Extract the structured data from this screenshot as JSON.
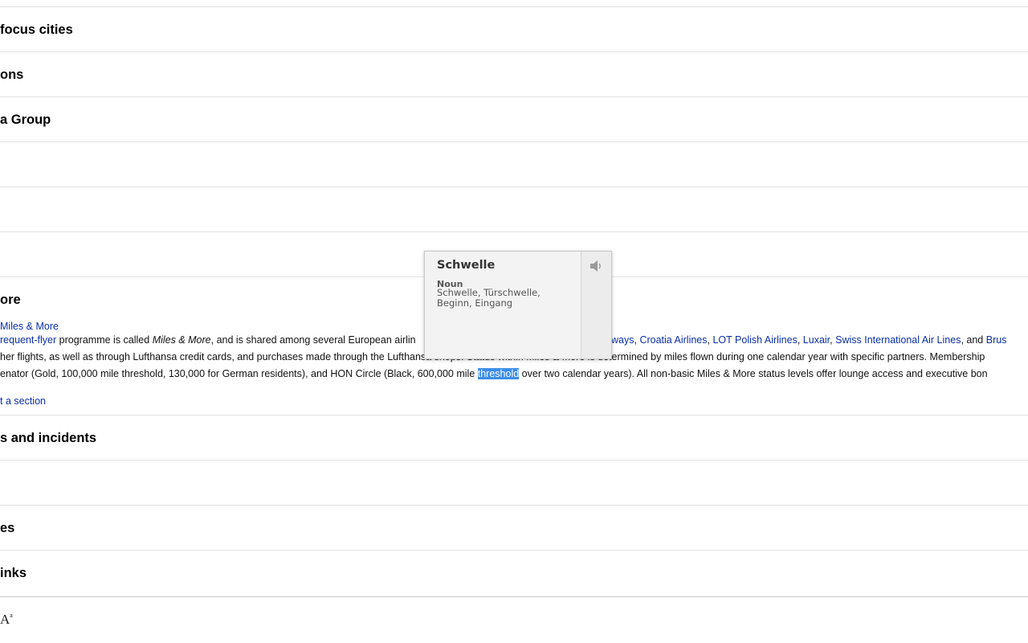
{
  "sections": [
    {
      "title": " focus cities"
    },
    {
      "title": "ons"
    },
    {
      "title": "a Group"
    },
    {
      "title": ""
    },
    {
      "title": ""
    },
    {
      "title": ""
    },
    {
      "title": "ore"
    },
    {
      "title": "s and incidents"
    },
    {
      "title": ""
    },
    {
      "title": "es"
    },
    {
      "title": "inks"
    }
  ],
  "main_article_link": "Miles & More",
  "paragraph": {
    "line1": {
      "link_frequent_flyer": "requent-flyer",
      "t1": " programme is called ",
      "em": "Miles & More",
      "t2": ", and is shared among several European airlin",
      "link_ways": "ways",
      "sep1": ", ",
      "link_croatia": "Croatia Airlines",
      "sep2": ", ",
      "link_lot": "LOT Polish Airlines",
      "sep3": ", ",
      "link_luxair": "Luxair",
      "sep4": ", ",
      "link_swiss": "Swiss International Air Lines",
      "t3": ", and ",
      "link_brus": "Brus"
    },
    "line2": {
      "t1": "her flights, as well as through Lufthansa credit cards, and purchases made through the Lufthansa shops. Status within Miles & More",
      "t2": " is determined by miles flown during one calendar year with specific partners. Membership"
    },
    "line3": {
      "t1": "enator (Gold, 100,000 mile threshold, 130,000 for German residents), and HON Circle (Black, 600,000 mile ",
      "highlight": "threshold",
      "t2": " over two calendar years). All non-basic Miles & More status levels offer lounge access and executive bon"
    }
  },
  "edit_section_link": "t a section",
  "popup": {
    "word": "Schwelle",
    "part_of_speech": "Noun",
    "definitions": "Schwelle, Türschwelle, Beginn, Eingang",
    "audio_icon": "speaker-icon"
  },
  "bottom_bar": {
    "font_size_label": "A",
    "font_size_sup": "a"
  },
  "colors": {
    "link": "#0b2fa8",
    "highlight": "#3c8de8",
    "divider": "#e2e2e2"
  }
}
